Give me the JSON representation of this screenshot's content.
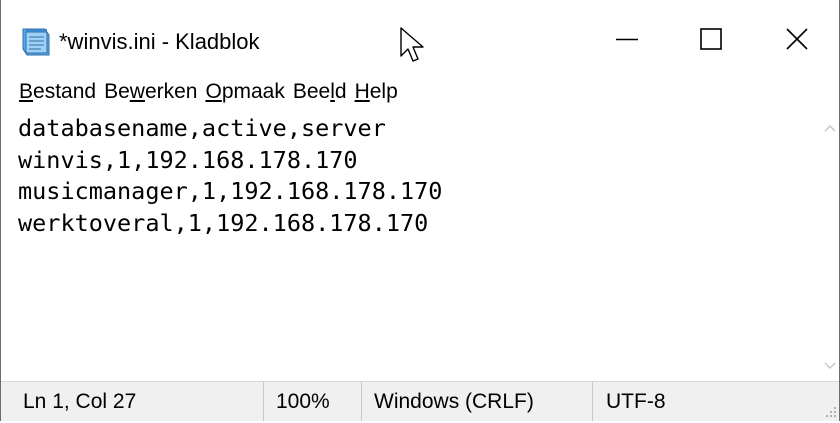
{
  "window": {
    "title": "*winvis.ini - Kladblok",
    "minimize_icon": "minimize-icon",
    "maximize_icon": "maximize-icon",
    "close_icon": "close-icon"
  },
  "menu": {
    "items": [
      {
        "pre": "",
        "u": "B",
        "post": "estand"
      },
      {
        "pre": "Be",
        "u": "w",
        "post": "erken"
      },
      {
        "pre": "",
        "u": "O",
        "post": "pmaak"
      },
      {
        "pre": "Bee",
        "u": "l",
        "post": "d"
      },
      {
        "pre": "",
        "u": "H",
        "post": "elp"
      }
    ]
  },
  "editor": {
    "lines": [
      "databasename,active,server",
      "winvis,1,192.168.178.170",
      "musicmanager,1,192.168.178.170",
      "werktoveral,1,192.168.178.170"
    ]
  },
  "status": {
    "position": "Ln 1, Col 27",
    "zoom": "100%",
    "line_ending": "Windows (CRLF)",
    "encoding": "UTF-8"
  },
  "colors": {
    "status_bg": "#f0f0f0",
    "icon_blue": "#5aa7e6"
  }
}
